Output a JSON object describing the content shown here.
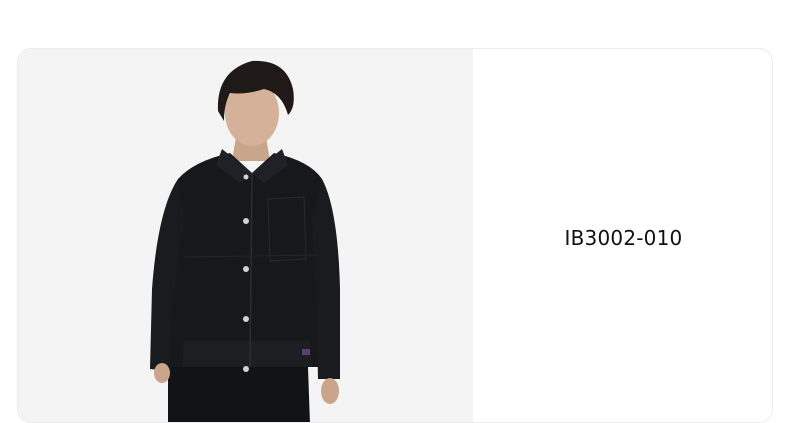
{
  "product_card": {
    "image_icon": "product-photo-model-wearing-black-jacket",
    "style_code": "IB3002-010"
  },
  "colors": {
    "image_background": "#f4f4f4",
    "jacket": "#17181b",
    "text": "#111111"
  }
}
